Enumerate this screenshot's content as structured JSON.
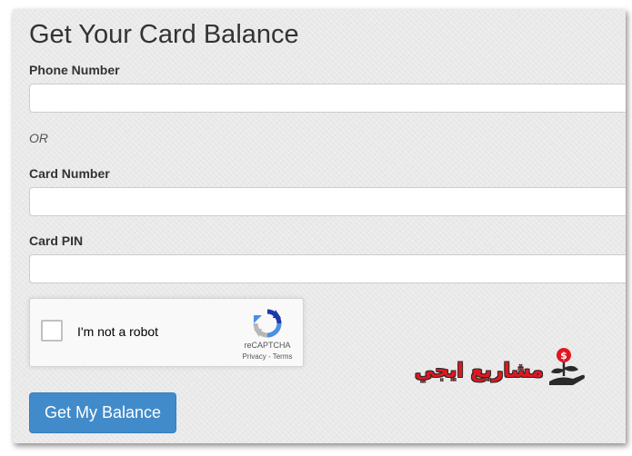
{
  "form": {
    "title": "Get Your Card Balance",
    "phone": {
      "label": "Phone Number",
      "value": "",
      "placeholder": ""
    },
    "or_text": "OR",
    "card_number": {
      "label": "Card Number",
      "value": "",
      "placeholder": ""
    },
    "card_pin": {
      "label": "Card PIN",
      "value": "",
      "placeholder": ""
    },
    "submit_label": "Get My Balance"
  },
  "recaptcha": {
    "label": "I'm not a robot",
    "brand": "reCAPTCHA",
    "privacy": "Privacy",
    "separator": " - ",
    "terms": "Terms",
    "checked": false
  },
  "watermark": {
    "text": "مشاريع ايجي",
    "icon": "money-hand-plant-icon"
  },
  "colors": {
    "button_bg": "#428bca",
    "panel_bg": "#e9e9e9",
    "watermark_red": "#e0171f"
  }
}
